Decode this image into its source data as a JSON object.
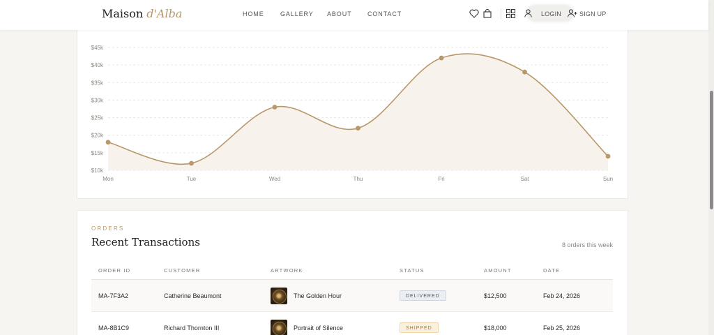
{
  "header": {
    "brand_main": "Maison",
    "brand_accent": "d'Alba",
    "nav": [
      "HOME",
      "GALLERY",
      "ABOUT",
      "CONTACT"
    ],
    "login_label": "LOGIN",
    "signup_label": "SIGN UP",
    "icons": [
      "heart-icon",
      "shopping-bag-icon",
      "grid-icon",
      "user-icon",
      "user-plus-icon"
    ]
  },
  "chart_data": {
    "type": "area",
    "x": [
      "Mon",
      "Tue",
      "Wed",
      "Thu",
      "Fri",
      "Sat",
      "Sun"
    ],
    "values": [
      18000,
      12000,
      28000,
      22000,
      42000,
      38000,
      14000
    ],
    "yticks": [
      "$10k",
      "$15k",
      "$20k",
      "$25k",
      "$30k",
      "$35k",
      "$40k",
      "$45k"
    ],
    "ylim": [
      10000,
      45000
    ],
    "grid": true,
    "color": "#b8976a",
    "fill_color": "#f7f3ec"
  },
  "orders": {
    "eyebrow": "ORDERS",
    "title": "Recent Transactions",
    "count_text": "8 orders this week",
    "columns": [
      "ORDER ID",
      "CUSTOMER",
      "ARTWORK",
      "STATUS",
      "AMOUNT",
      "DATE"
    ],
    "rows": [
      {
        "id": "MA-7F3A2",
        "customer": "Catherine Beaumont",
        "artwork": "The Golden Hour",
        "status": "DELIVERED",
        "amount": "$12,500",
        "date": "Feb 24, 2026"
      },
      {
        "id": "MA-8B1C9",
        "customer": "Richard Thornton III",
        "artwork": "Portrait of Silence",
        "status": "SHIPPED",
        "amount": "$18,000",
        "date": "Feb 25, 2026"
      }
    ]
  },
  "colors": {
    "accent": "#b8976a",
    "delivered": "#4d5966",
    "shipped": "#b07a2f"
  }
}
